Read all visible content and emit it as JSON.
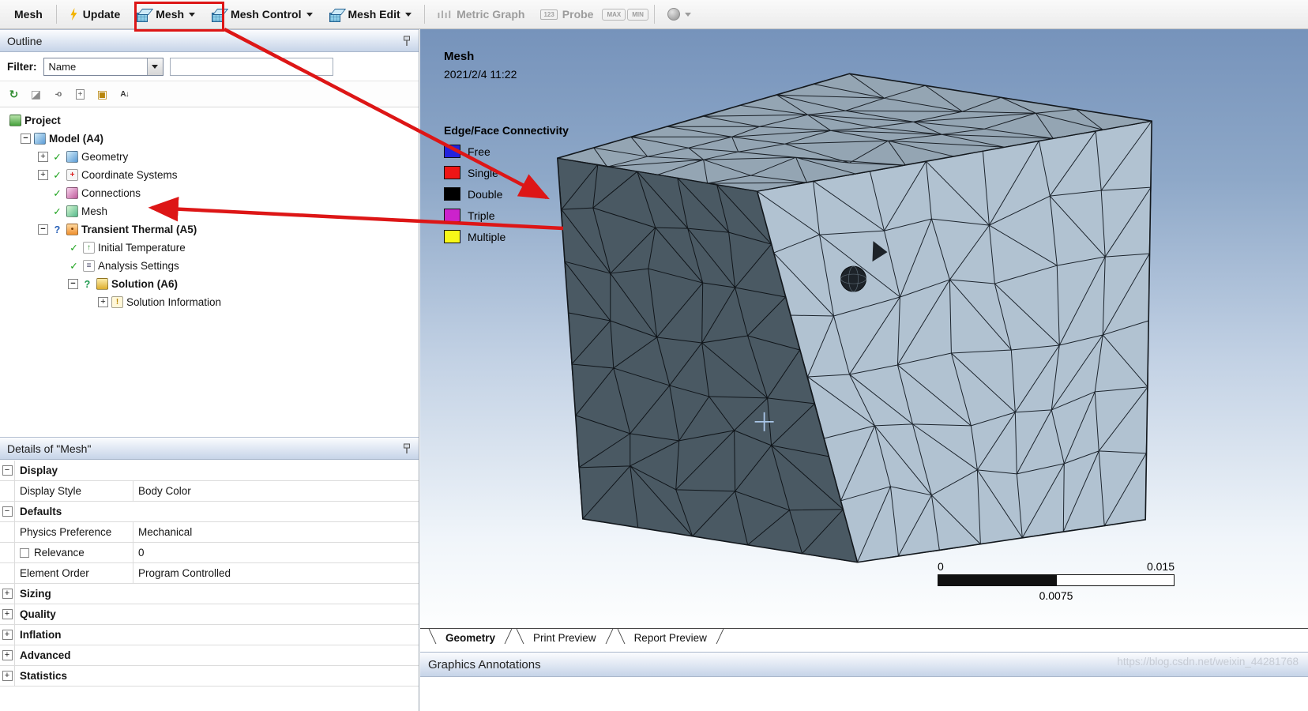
{
  "toolbar": {
    "menu_mesh": "Mesh",
    "update": "Update",
    "mesh": "Mesh",
    "mesh_control": "Mesh Control",
    "mesh_edit": "Mesh Edit",
    "metric_graph": "Metric Graph",
    "probe": "Probe",
    "max": "MAX",
    "min": "MIN"
  },
  "outline": {
    "title": "Outline",
    "filter_label": "Filter:",
    "filter_value": "Name",
    "search_value": "",
    "tree": {
      "project": "Project",
      "model": "Model (A4)",
      "geometry": "Geometry",
      "coordinate_systems": "Coordinate Systems",
      "connections": "Connections",
      "mesh": "Mesh",
      "transient_thermal": "Transient Thermal (A5)",
      "initial_temperature": "Initial Temperature",
      "analysis_settings": "Analysis Settings",
      "solution": "Solution (A6)",
      "solution_information": "Solution Information"
    }
  },
  "details": {
    "title": "Details of \"Mesh\"",
    "sections": {
      "display": "Display",
      "defaults": "Defaults",
      "sizing": "Sizing",
      "quality": "Quality",
      "inflation": "Inflation",
      "advanced": "Advanced",
      "statistics": "Statistics"
    },
    "rows": {
      "display_style_label": "Display Style",
      "display_style_value": "Body Color",
      "physics_preference_label": "Physics Preference",
      "physics_preference_value": "Mechanical",
      "relevance_label": "Relevance",
      "relevance_value": "0",
      "element_order_label": "Element Order",
      "element_order_value": "Program Controlled"
    }
  },
  "viewport": {
    "title": "Mesh",
    "timestamp": "2021/2/4 11:22",
    "legend_title": "Edge/Face Connectivity",
    "legend": [
      {
        "label": "Free",
        "color": "#2222dd"
      },
      {
        "label": "Single",
        "color": "#ee1515"
      },
      {
        "label": "Double",
        "color": "#000000"
      },
      {
        "label": "Triple",
        "color": "#cc22cc"
      },
      {
        "label": "Multiple",
        "color": "#f8f818"
      }
    ],
    "ruler_min": "0",
    "ruler_max": "0.015",
    "ruler_mid": "0.0075",
    "tab_geometry": "Geometry",
    "tab_print_preview": "Print Preview",
    "tab_report_preview": "Report Preview",
    "annotations_title": "Graphics Annotations",
    "watermark": "https://blog.csdn.net/weixin_44281768"
  }
}
